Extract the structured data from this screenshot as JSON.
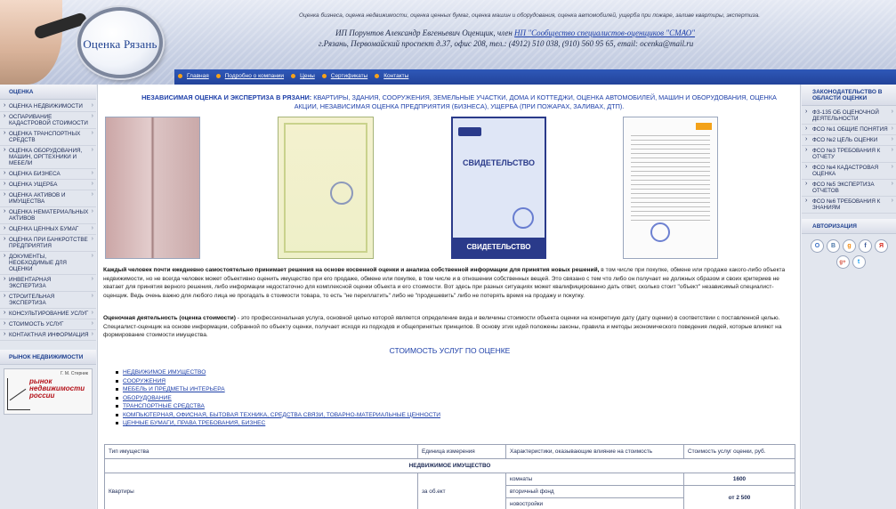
{
  "header": {
    "logo_text": "Оценка Рязань",
    "tagline": "Оценка бизнеса, оценка недвижимости, оценка ценных бумаг, оценка машин и оборудования, оценка автомобилей, ущерба при пожаре, заливе квартиры, экспертиза.",
    "name_text": "ИП Порунтов Александр Евгеньевич   Оценщик, член",
    "name_link": "НП \"Сообщество специалистов-оценщиков \"СМАО\"",
    "contacts": "г.Рязань, Первомайский проспект д.37, офис 208, тел.: (4912) 510 038, (910) 560 95 65, email: ocenka@mail.ru",
    "nav": [
      "Главная",
      "Подробно о компании",
      "Цены",
      "Сертификаты",
      "Контакты"
    ]
  },
  "left": {
    "section_title": "ОЦЕНКА",
    "items": [
      "ОЦЕНКА НЕДВИЖИМОСТИ",
      "ОСПАРИВАНИЕ КАДАСТРОВОЙ СТОИМОСТИ",
      "ОЦЕНКА ТРАНСПОРТНЫХ СРЕДСТВ",
      "ОЦЕНКА ОБОРУДОВАНИЯ, МАШИН, ОРГТЕХНИКИ И МЕБЕЛИ",
      "ОЦЕНКА БИЗНЕСА",
      "ОЦЕНКА УЩЕРБА",
      "ОЦЕНКА АКТИВОВ И ИМУЩЕСТВА",
      "ОЦЕНКА НЕМАТЕРИАЛЬНЫХ АКТИВОВ",
      "ОЦЕНКА ЦЕННЫХ БУМАГ",
      "ОЦЕНКА ПРИ БАНКРОТСТВЕ ПРЕДПРИЯТИЯ",
      "ДОКУМЕНТЫ, НЕОБХОДИМЫЕ ДЛЯ ОЦЕНКИ",
      "ИНВЕНТАРНАЯ ЭКСПЕРТИЗА",
      "СТРОИТЕЛЬНАЯ ЭКСПЕРТИЗА",
      "КОНСУЛЬТИРОВАНИЕ УСЛУГ",
      "СТОИМОСТЬ УСЛУГ",
      "КОНТАКТНАЯ ИНФОРМАЦИЯ"
    ],
    "market_title": "РЫНОК НЕДВИЖИМОСТИ",
    "market_author": "Г. М. Стерник",
    "market_text": "рынок недвижимости россии"
  },
  "main": {
    "intro_label": "НЕЗАВИСИМАЯ ОЦЕНКА И ЭКСПЕРТИЗА В РЯЗАНИ:",
    "intro_text": "КВАРТИРЫ, ЗДАНИЯ,   СООРУЖЕНИЯ, ЗЕМЕЛЬНЫЕ УЧАСТКИ, ДОМА И КОТТЕДЖИ, ОЦЕНКА АВТОМОБИЛЕЙ, МАШИН И ОБОРУДОВАНИЯ, ОЦЕНКА АКЦИИ, НЕЗАВИСИМАЯ ОЦЕНКА ПРЕДПРИЯТИЯ (БИЗНЕСА), УЩЕРБА (ПРИ ПОЖАРАХ, ЗАЛИВАХ, ДТП).",
    "cert3_title": "СВИДЕТЕЛЬСТВО",
    "cert3_bottom": "СВИДЕТЕЛЬСТВО",
    "para1_bold": "Каждый человек почти ежедневно самостоятельно принимает решения на основе косвенной оценки и анализа собственной информации для принятия новых решений,",
    "para1_text": " в том числе при покупке, обмене или продаже какого-либо объекта недвижимости, но не всегда человек может объективно оценить имущество при его продаже, обмене или покупке, в том числе и в отношении собственных вещей. Это связано с тем что либо он получает не должных образом и своих критериев не хватает для принятия верного решения, либо информации недостаточно для комплексной оценки объекта и его стоимости. Вот здесь при разных ситуациях может квалифицированно дать ответ, сколько стоит \"объект\" независимый специалист-оценщик. Ведь очень важно для любого лица не прогадать в стоимости товара, то есть \"не переплатить\" либо не \"продешевить\" либо не потерять время на продажу и покупку.",
    "para2_bold": "Оценочная деятельность (оценка стоимости)",
    "para2_text": " - это профессиональная услуга, основной целью которой является определение вида и величины стоимости объекта оценки на конкретную дату (дату оценки) в соответствии с поставленной целью. Специалист-оценщик на основе информации, собранной по объекту оценки, получает исходя из подходов и общепринятых принципов. В основу этих идей положены законы, правила и методы экономического поведения людей, которые влияют на формирование стоимости имущества.",
    "services_title": "СТОИМОСТЬ УСЛУГ ПО ОЦЕНКЕ",
    "services": [
      "НЕДВИЖИМОЕ ИМУЩЕСТВО",
      "СООРУЖЕНИЯ",
      "МЕБЕЛЬ И ПРЕДМЕТЫ ИНТЕРЬЕРА",
      "ОБОРУДОВАНИЕ",
      "ТРАНСПОРТНЫЕ СРЕДСТВА",
      "КОМПЬЮТЕРНАЯ, ОФИСНАЯ, БЫТОВАЯ ТЕХНИКА, СРЕДСТВА СВЯЗИ, ТОВАРНО-МАТЕРИАЛЬНЫЕ ЦЕННОСТИ",
      "ЦЕННЫЕ БУМАГИ, ПРАВА ТРЕБОВАНИЯ, БИЗНЕС"
    ],
    "table": {
      "headers": [
        "Тип имущества",
        "Единица измерения",
        "Характеристики, оказывающие влияние на стоимость",
        "Стоимость услуг оценки, руб."
      ],
      "section": "НЕДВИЖИМОЕ ИМУЩЕСТВО",
      "row_type": "Квартиры",
      "row_unit": "за об.ект",
      "characteristics": [
        "комнаты",
        "вторичный фонд",
        "новостройки"
      ],
      "price_1": "1600",
      "price_2": "от 2 500"
    }
  },
  "right": {
    "law_title": "ЗАКОНОДАТЕЛЬСТВО В ОБЛАСТИ ОЦЕНКИ",
    "law_items": [
      "ФЗ-135 ОБ ОЦЕНОЧНОЙ ДЕЯТЕЛЬНОСТИ",
      "ФСО №1 ОБЩИЕ ПОНЯТИЯ",
      "ФСО №2 ЦЕЛЬ ОЦЕНКИ",
      "ФСО №3 ТРЕБОВАНИЯ К ОТЧЕТУ",
      "ФСО №4 КАДАСТРОВАЯ ОЦЕНКА",
      "ФСО №5 ЭКСПЕРТИЗА ОТЧЕТОВ",
      "ФСО №6 ТРЕБОВАНИЯ К ЗНАНИЯМ"
    ],
    "auth_title": "АВТОРИЗАЦИЯ",
    "socials": [
      "O",
      "B",
      "g",
      "f",
      "Я",
      "g+",
      "t"
    ]
  }
}
